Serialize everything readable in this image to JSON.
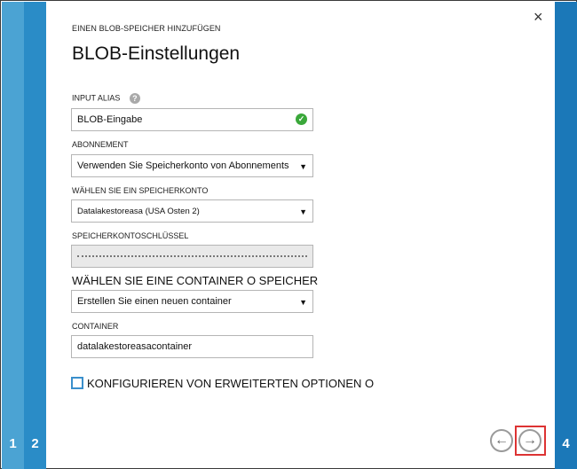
{
  "wizard": {
    "breadcrumb": "EINEN BLOB-SPEICHER HINZUFÜGEN",
    "title": "BLOB-Einstellungen",
    "steps": {
      "step1": "1",
      "step2": "2",
      "step4": "4"
    }
  },
  "form": {
    "input_alias": {
      "label": "INPUT ALIAS",
      "value": "BLOB-Eingabe"
    },
    "abonnement": {
      "label": "ABONNEMENT",
      "selected": "Verwenden Sie Speicherkonto von Abonnements"
    },
    "speicherkonto": {
      "label": "WÄHLEN SIE EIN SPEICHERKONTO",
      "selected": "Datalakestoreasa (USA Osten 2)"
    },
    "schluessel": {
      "label": "SPEICHERKONTOSCHLÜSSEL"
    },
    "container_choice": {
      "label": "WÄHLEN SIE EINE CONTAINER O SPEICHER",
      "selected": "Erstellen Sie einen neuen container"
    },
    "container": {
      "label": "CONTAINER",
      "value": "datalakestoreasacontainer"
    },
    "advanced": {
      "label": "KONFIGURIEREN VON ERWEITERTEN OPTIONEN O"
    }
  },
  "icons": {
    "close": "×",
    "help": "?",
    "check": "✓",
    "caret": "▼",
    "back": "←",
    "next": "→"
  },
  "colors": {
    "step1": "#4ba3d3",
    "step2": "#2a8cc7",
    "step4": "#1b78b8",
    "success": "#3aa83a",
    "highlight": "#d33"
  }
}
